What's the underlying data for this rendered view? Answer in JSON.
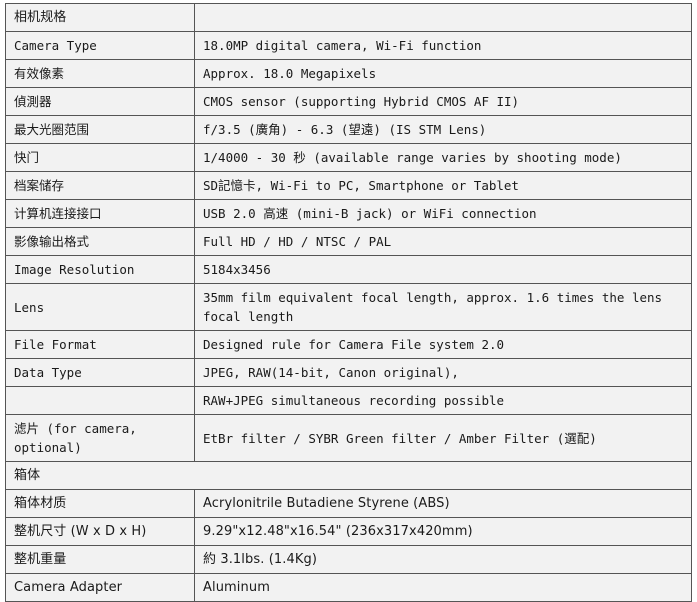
{
  "table": {
    "columns": [
      "label",
      "value"
    ],
    "rows": [
      {
        "id": "camera-spec-header",
        "label": "相机规格",
        "value": "",
        "font": "sans",
        "span": false,
        "tall": false
      },
      {
        "id": "camera-type",
        "label": "Camera Type",
        "value": "18.0MP digital camera, Wi-Fi function",
        "font": "mono",
        "span": false,
        "tall": false
      },
      {
        "id": "effective-pixels",
        "label": "有效像素",
        "value": "Approx. 18.0 Megapixels",
        "font": "mono",
        "span": false,
        "tall": false
      },
      {
        "id": "sensor",
        "label": "偵測器",
        "value": "CMOS sensor (supporting Hybrid CMOS AF II)",
        "font": "mono",
        "span": false,
        "tall": false
      },
      {
        "id": "max-aperture-range",
        "label": "最大光圈范围",
        "value": "f/3.5 (廣角) - 6.3 (望遠) (IS STM Lens)",
        "font": "mono",
        "span": false,
        "tall": false
      },
      {
        "id": "shutter",
        "label": "快门",
        "value": "1/4000 - 30 秒 (available range varies by shooting mode)",
        "font": "mono",
        "span": false,
        "tall": false
      },
      {
        "id": "file-storage",
        "label": "档案储存",
        "value": "SD記憶卡, Wi-Fi to PC, Smartphone or Tablet",
        "font": "mono",
        "span": false,
        "tall": false
      },
      {
        "id": "computer-interface",
        "label": "计算机连接接口",
        "value": "USB 2.0 高速 (mini-B jack) or WiFi connection",
        "font": "mono",
        "span": false,
        "tall": false
      },
      {
        "id": "video-output-format",
        "label": "影像输出格式",
        "value": "Full HD / HD / NTSC / PAL",
        "font": "mono",
        "span": false,
        "tall": false
      },
      {
        "id": "image-resolution",
        "label": "Image Resolution",
        "value": "5184x3456",
        "font": "mono",
        "span": false,
        "tall": false
      },
      {
        "id": "lens",
        "label": "Lens",
        "value": "35mm film equivalent focal length, approx. 1.6 times the lens focal length",
        "font": "mono",
        "span": false,
        "tall": true
      },
      {
        "id": "file-format",
        "label": "File Format",
        "value": "Designed rule for Camera File system 2.0",
        "font": "mono",
        "span": false,
        "tall": false
      },
      {
        "id": "data-type",
        "label": "Data Type",
        "value": "JPEG, RAW(14-bit, Canon original),",
        "font": "mono",
        "span": false,
        "tall": false
      },
      {
        "id": "data-type-cont",
        "label": "",
        "value": "RAW+JPEG simultaneous recording possible",
        "font": "mono",
        "span": false,
        "tall": false
      },
      {
        "id": "filter",
        "label": "滤片 (for camera, optional)",
        "value": "EtBr filter / SYBR Green filter / Amber Filter (選配)",
        "font": "mono",
        "span": false,
        "tall": true
      },
      {
        "id": "cabinet-header",
        "label": "箱体",
        "value": "",
        "font": "sans",
        "span": true,
        "tall": false
      },
      {
        "id": "cabinet-material",
        "label": "箱体材质",
        "value": "Acrylonitrile Butadiene Styrene (ABS)",
        "font": "sans",
        "span": false,
        "tall": false
      },
      {
        "id": "overall-dimensions",
        "label": "整机尺寸 (W x D x H)",
        "value": "9.29\"x12.48\"x16.54\" (236x317x420mm)",
        "font": "sans",
        "span": false,
        "tall": false
      },
      {
        "id": "overall-weight",
        "label": "整机重量",
        "value": "約 3.1lbs. (1.4Kg)",
        "font": "sans",
        "span": false,
        "tall": false
      },
      {
        "id": "camera-adapter",
        "label": "Camera Adapter",
        "value": "Aluminum",
        "font": "sans",
        "span": false,
        "tall": false
      }
    ]
  },
  "style": {
    "background": "#f2f2f2",
    "border": "#555555",
    "text": "#1a1a1a"
  }
}
